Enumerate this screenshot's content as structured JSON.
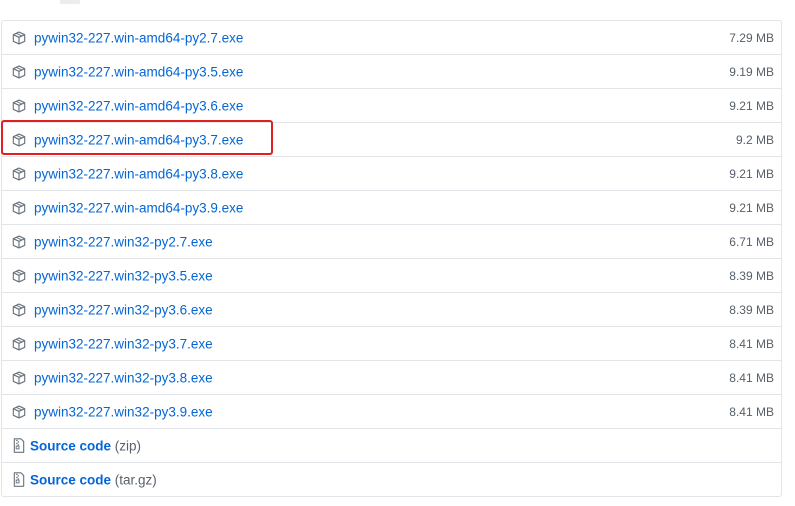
{
  "assets": [
    {
      "name": "pywin32-227.win-amd64-py2.7.exe",
      "size": "7.29 MB",
      "icon": "package-icon"
    },
    {
      "name": "pywin32-227.win-amd64-py3.5.exe",
      "size": "9.19 MB",
      "icon": "package-icon"
    },
    {
      "name": "pywin32-227.win-amd64-py3.6.exe",
      "size": "9.21 MB",
      "icon": "package-icon"
    },
    {
      "name": "pywin32-227.win-amd64-py3.7.exe",
      "size": "9.2 MB",
      "icon": "package-icon",
      "highlighted": true
    },
    {
      "name": "pywin32-227.win-amd64-py3.8.exe",
      "size": "9.21 MB",
      "icon": "package-icon"
    },
    {
      "name": "pywin32-227.win-amd64-py3.9.exe",
      "size": "9.21 MB",
      "icon": "package-icon"
    },
    {
      "name": "pywin32-227.win32-py2.7.exe",
      "size": "6.71 MB",
      "icon": "package-icon"
    },
    {
      "name": "pywin32-227.win32-py3.5.exe",
      "size": "8.39 MB",
      "icon": "package-icon"
    },
    {
      "name": "pywin32-227.win32-py3.6.exe",
      "size": "8.39 MB",
      "icon": "package-icon"
    },
    {
      "name": "pywin32-227.win32-py3.7.exe",
      "size": "8.41 MB",
      "icon": "package-icon"
    },
    {
      "name": "pywin32-227.win32-py3.8.exe",
      "size": "8.41 MB",
      "icon": "package-icon"
    },
    {
      "name": "pywin32-227.win32-py3.9.exe",
      "size": "8.41 MB",
      "icon": "package-icon"
    }
  ],
  "sources": [
    {
      "label": "Source code",
      "format": "(zip)",
      "icon": "file-zip-icon"
    },
    {
      "label": "Source code",
      "format": "(tar.gz)",
      "icon": "file-zip-icon"
    }
  ],
  "colors": {
    "link": "#0366d6",
    "muted": "#586069",
    "border": "#e1e4e8",
    "highlight": "#e02020"
  }
}
